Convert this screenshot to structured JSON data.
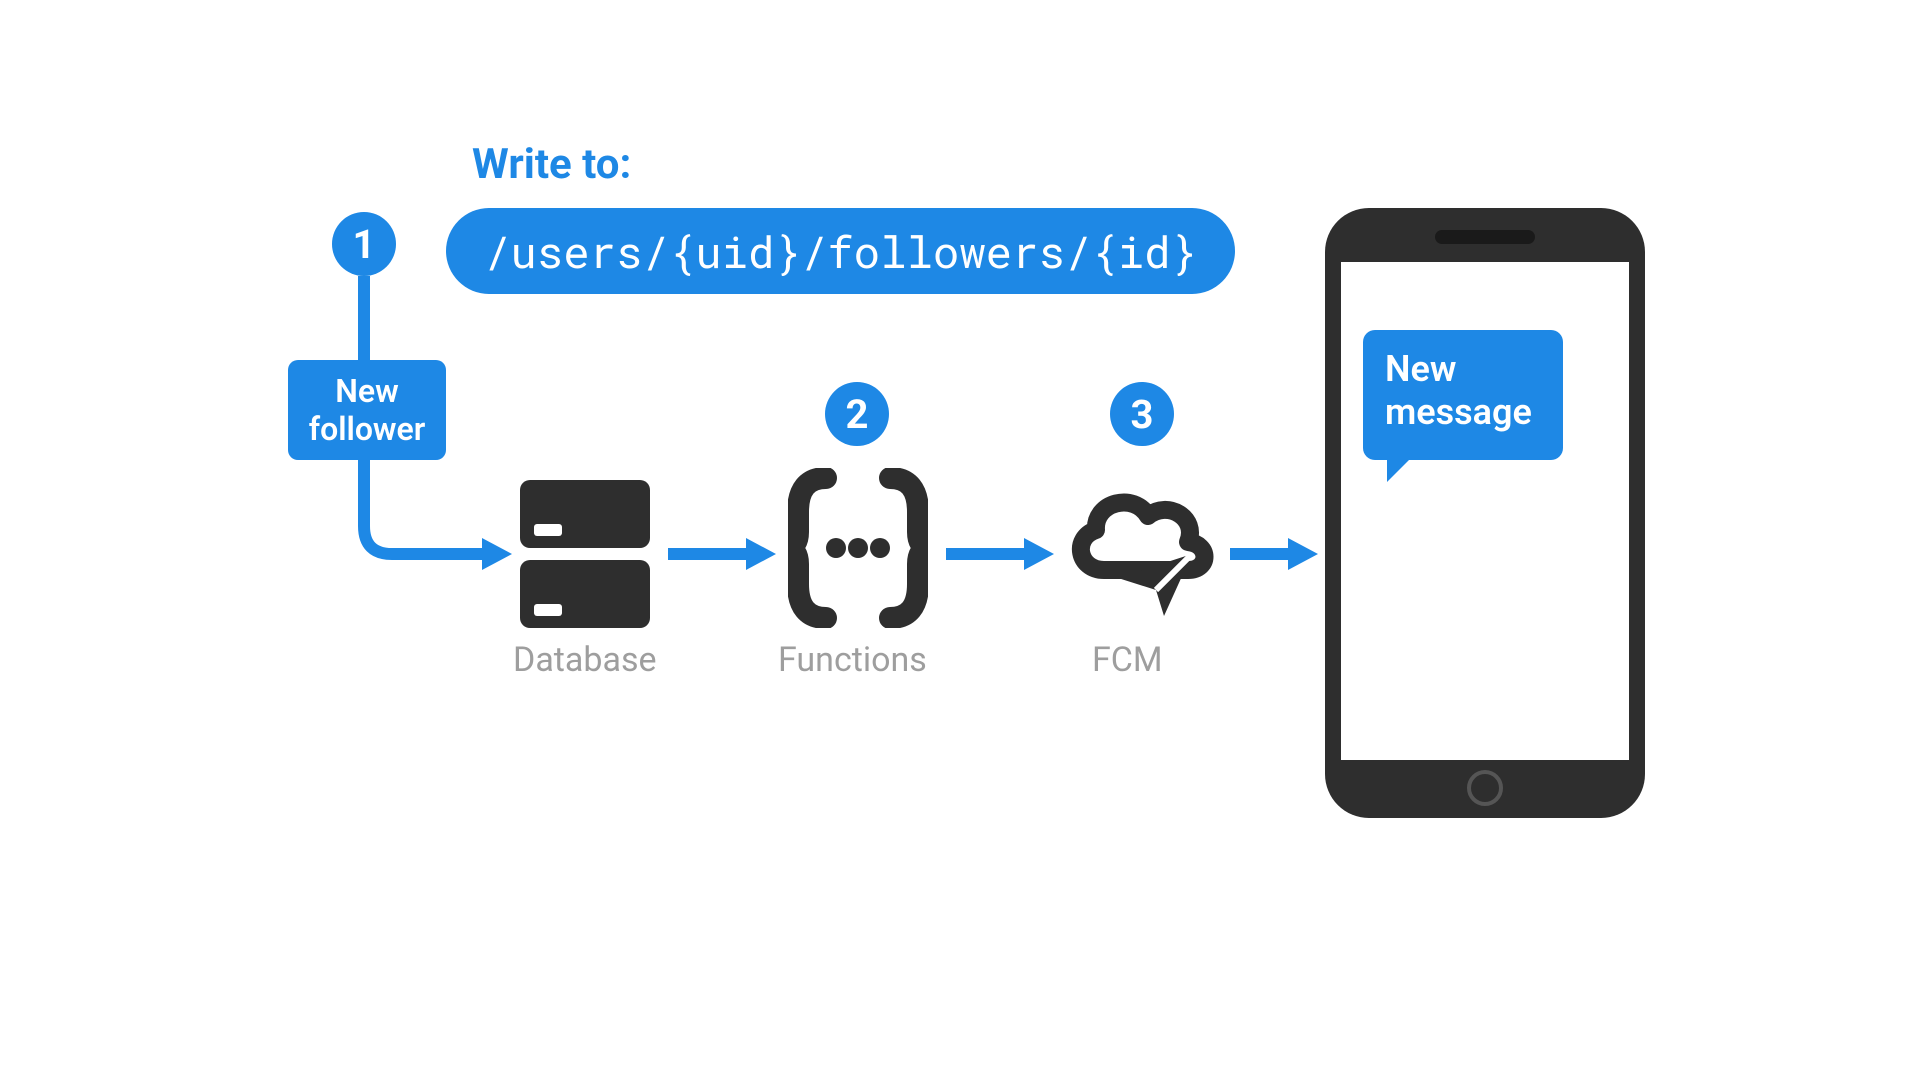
{
  "header": {
    "write_label": "Write to:",
    "code_path": "/users/{uid}/followers/{id}"
  },
  "steps": {
    "s1": "1",
    "s2": "2",
    "s3": "3"
  },
  "trigger_box": "New\nfollower",
  "nodes": {
    "database": "Database",
    "functions": "Functions",
    "fcm": "FCM"
  },
  "phone_bubble": "New\nmessage",
  "colors": {
    "accent": "#1e88e5",
    "icon": "#2e2e2e",
    "muted": "#9e9e9e"
  }
}
